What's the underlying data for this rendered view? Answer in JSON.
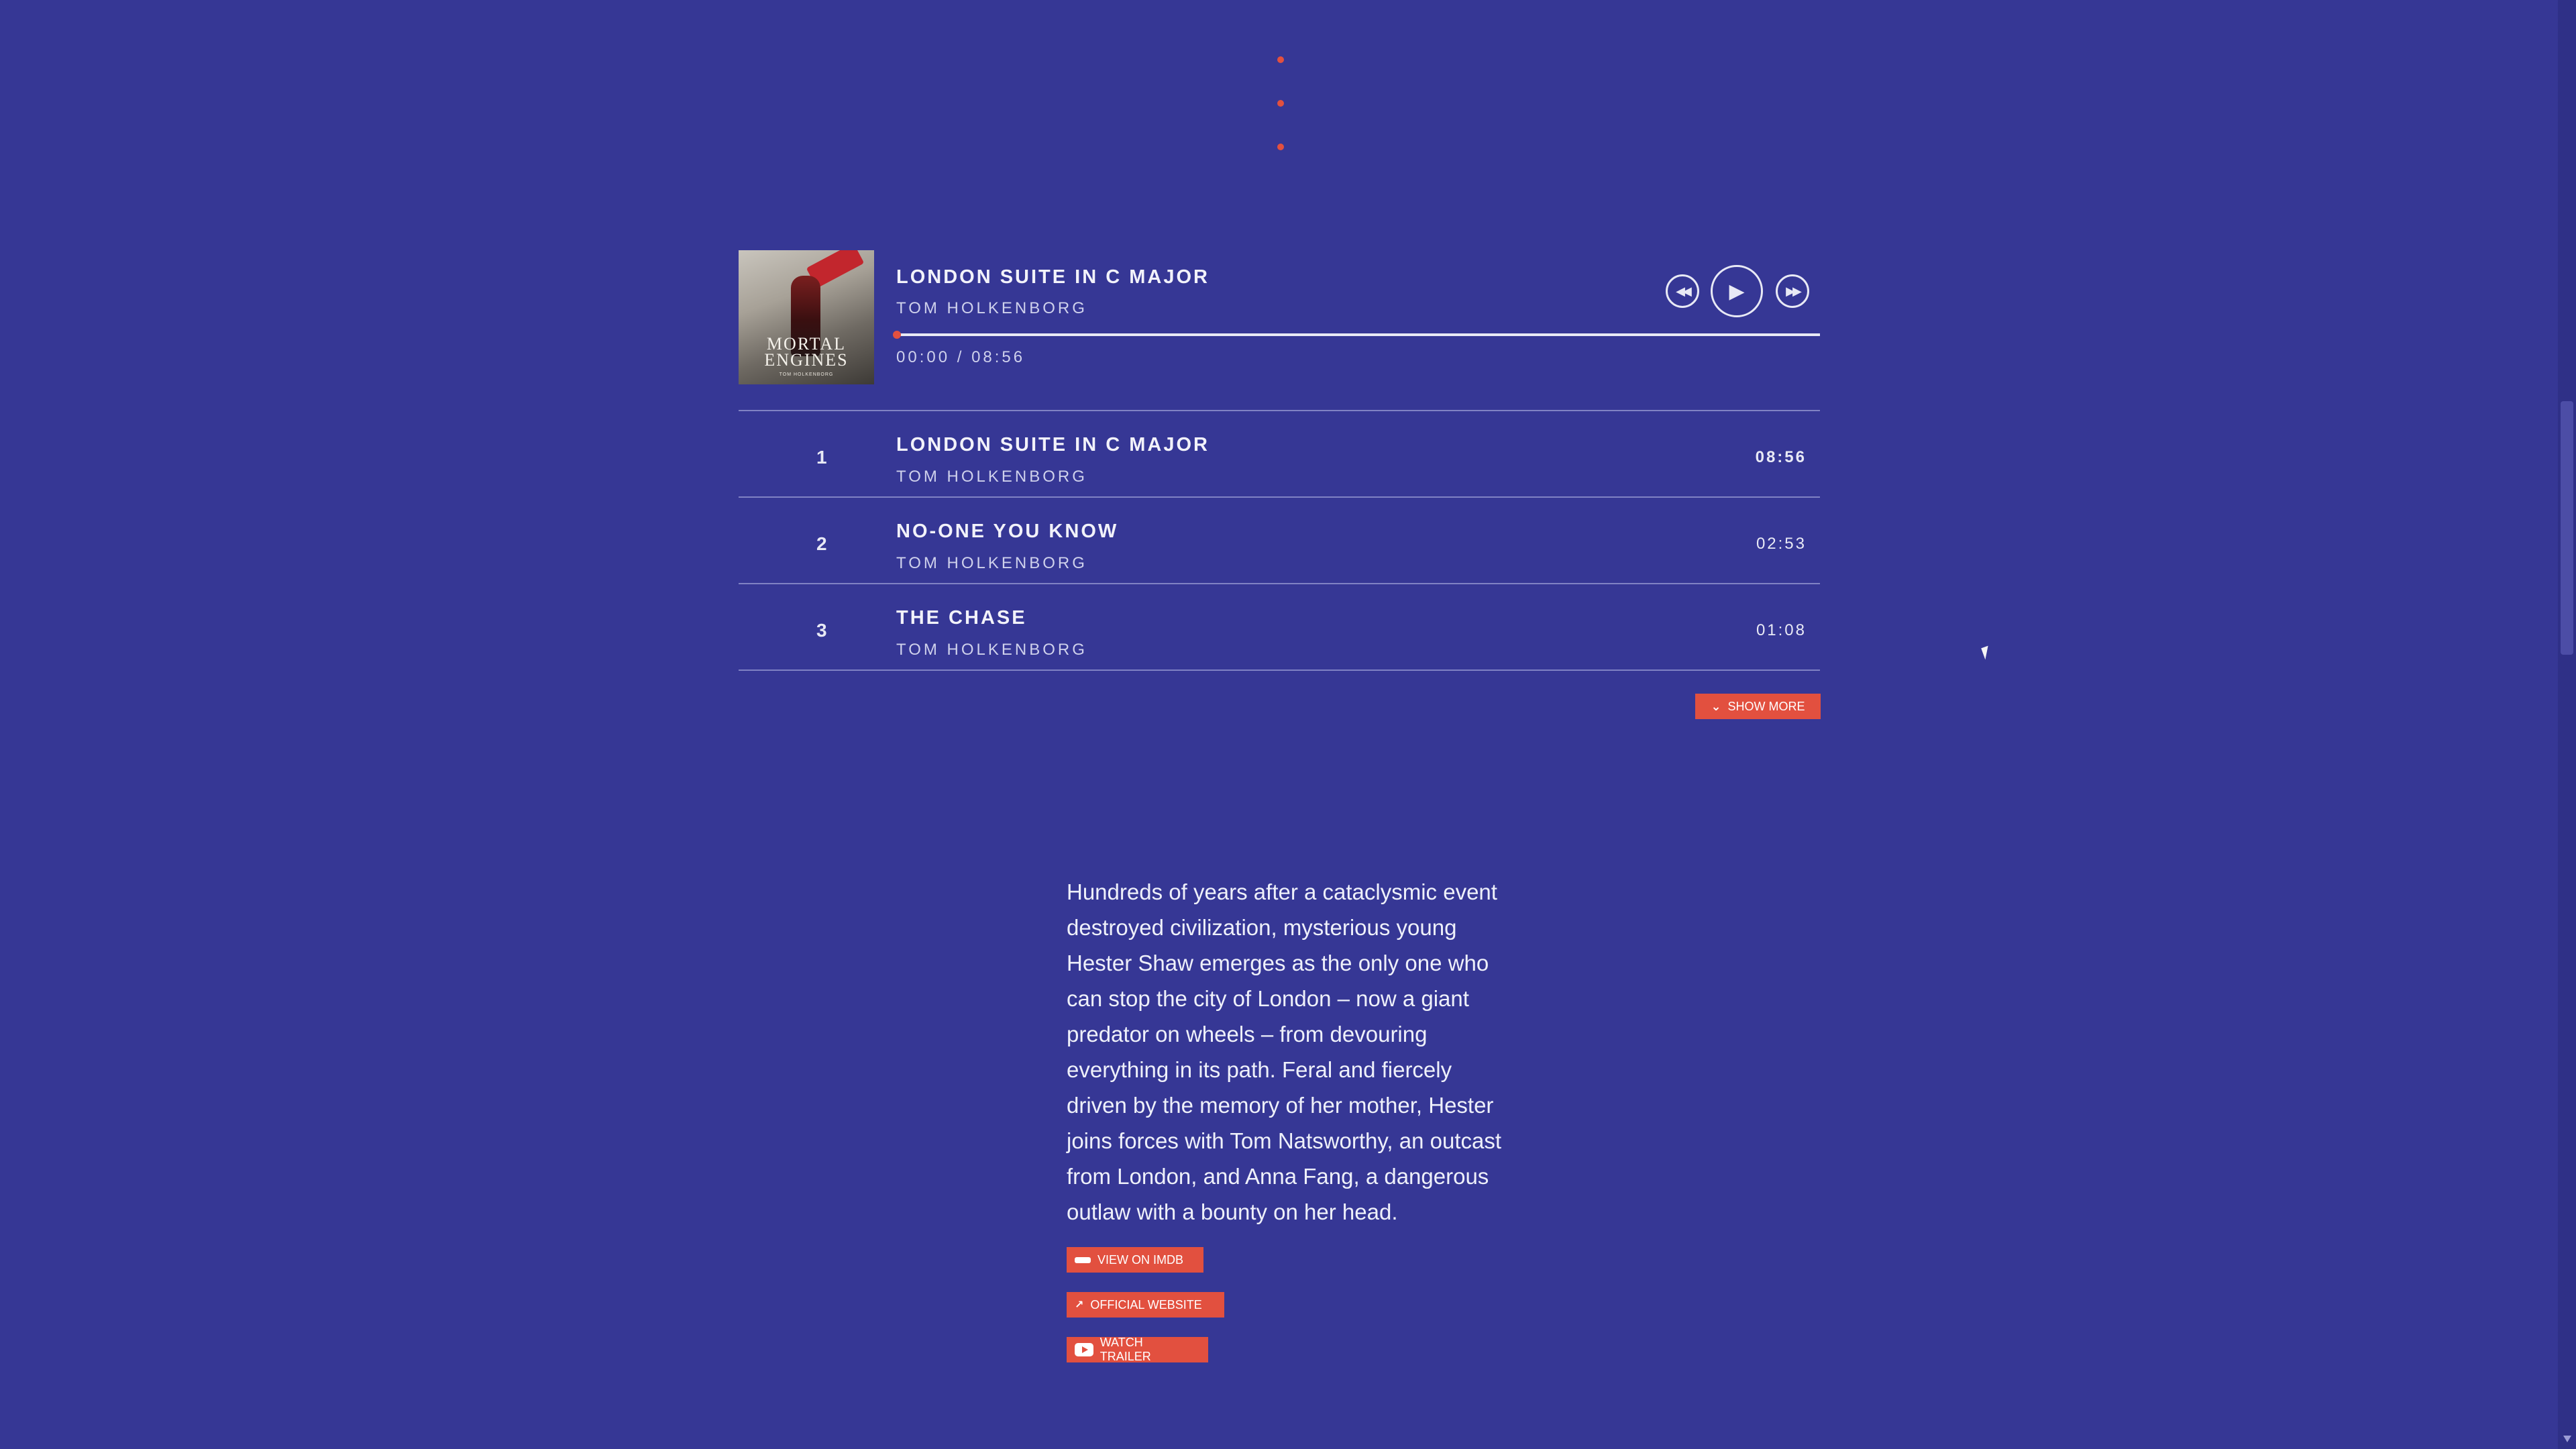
{
  "player": {
    "cover": {
      "title": "MORTAL ENGINES",
      "subtitle": "TOM HOLKENBORG",
      "name": "album-cover"
    },
    "now_playing": {
      "title": "LONDON SUITE IN C MAJOR",
      "artist": "TOM HOLKENBORG",
      "time": "00:00 / 08:56",
      "progress": 0.0
    },
    "controls": {
      "rewind_icon": "rewind-icon",
      "play_icon": "play-icon",
      "forward_icon": "fast-forward-icon"
    }
  },
  "tracks": [
    {
      "number": "1",
      "title": "LONDON SUITE IN C MAJOR",
      "artist": "TOM HOLKENBORG",
      "duration": "08:56"
    },
    {
      "number": "2",
      "title": "NO-ONE YOU KNOW",
      "artist": "TOM HOLKENBORG",
      "duration": "02:53"
    },
    {
      "number": "3",
      "title": "THE CHASE",
      "artist": "TOM HOLKENBORG",
      "duration": "01:08"
    }
  ],
  "show_more": {
    "label": "SHOW MORE",
    "icon": "chevron-down-icon"
  },
  "description": "Hundreds of years after a cataclysmic event destroyed civilization, mysterious young Hester Shaw emerges as the only one who can stop the city of London – now a giant predator on wheels – from devouring everything in its path. Feral and fiercely driven by the memory of her mother, Hester joins forces with Tom Natsworthy, an outcast from London, and Anna Fang, a dangerous outlaw with a bounty on her head.",
  "links": {
    "imdb": {
      "label": "VIEW ON IMDB",
      "icon": "imdb-icon"
    },
    "website": {
      "label": "OFFICIAL WEBSITE",
      "icon": "external-link-icon"
    },
    "trailer": {
      "label": "WATCH TRAILER",
      "icon": "youtube-icon"
    }
  },
  "colors": {
    "background": "#363795",
    "accent": "#e2503f",
    "text": "#e8e9f5"
  }
}
